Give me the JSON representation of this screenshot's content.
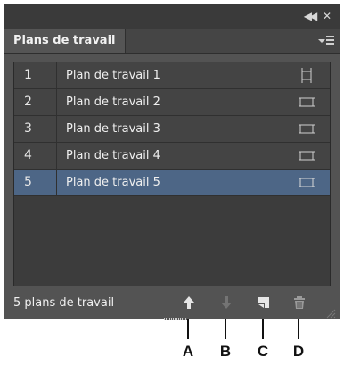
{
  "panel": {
    "tab_label": "Plans de travail",
    "rows": [
      {
        "number": "1",
        "name": "Plan de travail 1",
        "selected": false
      },
      {
        "number": "2",
        "name": "Plan de travail 2",
        "selected": false
      },
      {
        "number": "3",
        "name": "Plan de travail 3",
        "selected": false
      },
      {
        "number": "4",
        "name": "Plan de travail 4",
        "selected": false
      },
      {
        "number": "5",
        "name": "Plan de travail 5",
        "selected": true
      }
    ],
    "footer_count": "5 plans de travail",
    "footer_icons": [
      "move-up-icon",
      "move-down-icon",
      "new-artboard-icon",
      "delete-icon"
    ]
  },
  "callouts": [
    "A",
    "B",
    "C",
    "D"
  ],
  "colors": {
    "panel_bg": "#535353",
    "selected_row": "#4d6686",
    "row_bg": "#444444"
  }
}
